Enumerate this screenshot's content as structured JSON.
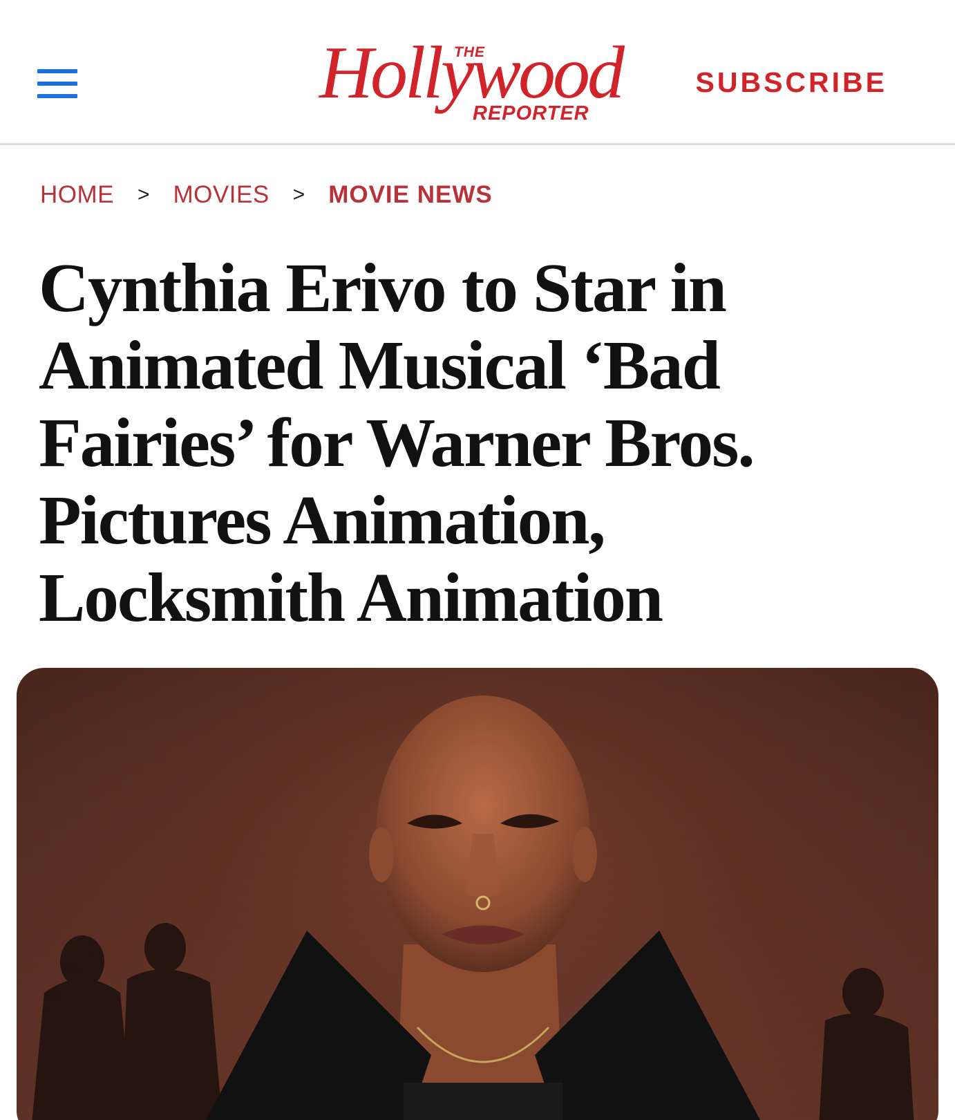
{
  "header": {
    "menu_icon": "hamburger-menu-icon",
    "logo": {
      "the": "THE",
      "main": "Hollywood",
      "reporter": "REPORTER"
    },
    "subscribe_label": "SUBSCRIBE",
    "colors": {
      "brand_red": "#d1232a",
      "menu_blue": "#1f6fdc"
    }
  },
  "breadcrumb": {
    "items": [
      "HOME",
      "MOVIES",
      "MOVIE NEWS"
    ],
    "separator": ">"
  },
  "article": {
    "headline": "Cynthia Erivo to Star in Animated Musical ‘Bad Fairies’ for Warner Bros. Pictures Animation, Locksmith Animation"
  }
}
